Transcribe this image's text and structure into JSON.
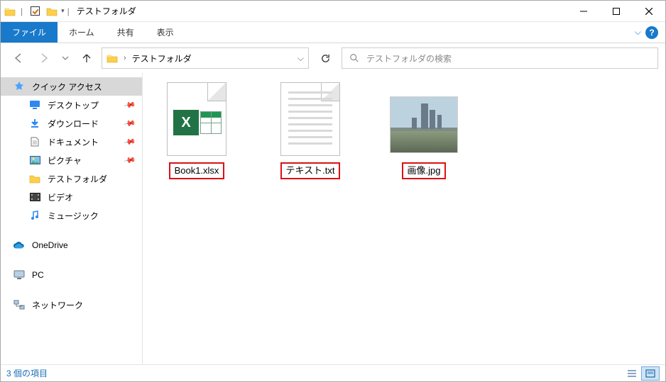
{
  "title": "テストフォルダ",
  "ribbon": {
    "file": "ファイル",
    "home": "ホーム",
    "share": "共有",
    "view": "表示"
  },
  "address": {
    "path": "テストフォルダ"
  },
  "search": {
    "placeholder": "テストフォルダの検索"
  },
  "sidebar": {
    "quick_access": "クイック アクセス",
    "desktop": "デスクトップ",
    "downloads": "ダウンロード",
    "documents": "ドキュメント",
    "pictures": "ピクチャ",
    "test_folder": "テストフォルダ",
    "videos": "ビデオ",
    "music": "ミュージック",
    "onedrive": "OneDrive",
    "pc": "PC",
    "network": "ネットワーク"
  },
  "files": [
    {
      "name": "Book1.xlsx",
      "type": "excel"
    },
    {
      "name": "テキスト.txt",
      "type": "text"
    },
    {
      "name": "画像.jpg",
      "type": "image"
    }
  ],
  "status": {
    "text": "3 個の項目"
  }
}
